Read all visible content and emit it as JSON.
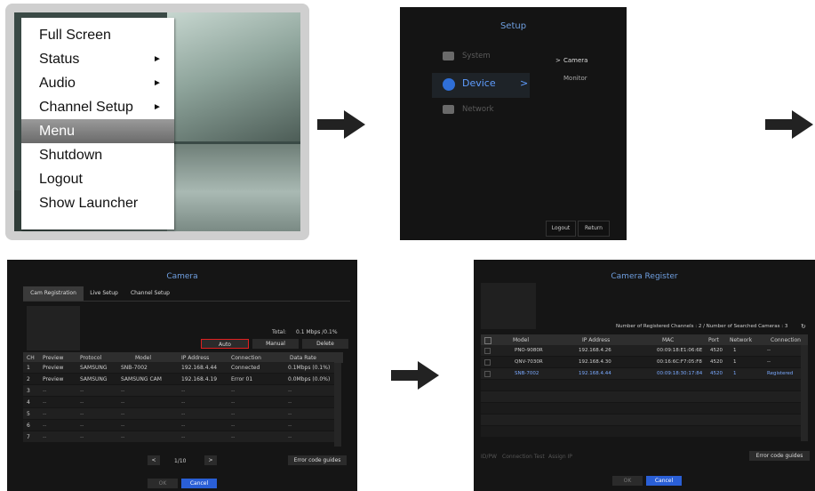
{
  "menu": {
    "items": [
      {
        "label": "Full Screen",
        "submenu": false
      },
      {
        "label": "Status",
        "submenu": true
      },
      {
        "label": "Audio",
        "submenu": true
      },
      {
        "label": "Channel Setup",
        "submenu": true
      },
      {
        "label": "Menu",
        "submenu": false,
        "selected": true
      },
      {
        "label": "Shutdown",
        "submenu": false
      },
      {
        "label": "Logout",
        "submenu": false
      },
      {
        "label": "Show Launcher",
        "submenu": false
      }
    ],
    "submenu_glyph": "►"
  },
  "setup": {
    "title": "Setup",
    "items": [
      {
        "label": "System",
        "icon": "monitor-gear-icon"
      },
      {
        "label": "Device",
        "icon": "camera-icon",
        "active": true
      },
      {
        "label": "Network",
        "icon": "network-icon"
      }
    ],
    "submenu": [
      "Camera",
      "Monitor"
    ],
    "submenu_prefix": ">",
    "device_chevron": ">",
    "logout_label": "Logout",
    "return_label": "Return"
  },
  "camera": {
    "title": "Camera",
    "tabs": [
      "Cam Registration",
      "Live Setup",
      "Channel Setup"
    ],
    "total_label": "Total:",
    "total_value": "0.1  Mbps /0.1%",
    "auto_label": "Auto",
    "manual_label": "Manual",
    "delete_label": "Delete",
    "columns": [
      "CH",
      "Preview",
      "Protocol",
      "Model",
      "IP Address",
      "Connection",
      "Data Rate"
    ],
    "rows": [
      [
        "1",
        "Preview",
        "SAMSUNG",
        "SNB-7002",
        "192.168.4.44",
        "Connected",
        "0.1Mbps (0.1%)"
      ],
      [
        "2",
        "Preview",
        "SAMSUNG",
        "SAMSUNG CAM",
        "192.168.4.19",
        "Error 01",
        "0.0Mbps (0.0%)"
      ],
      [
        "3",
        "--",
        "--",
        "--",
        "--",
        "--",
        "--"
      ],
      [
        "4",
        "--",
        "--",
        "--",
        "--",
        "--",
        "--"
      ],
      [
        "5",
        "--",
        "--",
        "--",
        "--",
        "--",
        "--"
      ],
      [
        "6",
        "--",
        "--",
        "--",
        "--",
        "--",
        "--"
      ],
      [
        "7",
        "--",
        "--",
        "--",
        "--",
        "--",
        "--"
      ]
    ],
    "page_prev": "<",
    "page_next": ">",
    "page_label": "1/10",
    "error_guides": "Error code guides",
    "ok_label": "OK",
    "cancel_label": "Cancel"
  },
  "register": {
    "title": "Camera Register",
    "summary": "Number of Registered Channels : 2 / Number of Searched Cameras : 3",
    "refresh_glyph": "↻",
    "columns": [
      "Model",
      "IP Address",
      "MAC",
      "Port",
      "Network",
      "Connection"
    ],
    "rows": [
      {
        "cells": [
          "PNO-9080R",
          "192.168.4.26",
          "00:09:18:E1:06:6E",
          "4520",
          "1",
          "--"
        ],
        "highlight": false
      },
      {
        "cells": [
          "QNV-7030R",
          "192.168.4.30",
          "00:16:6C:F7:05:F8",
          "4520",
          "1",
          "--"
        ],
        "highlight": false
      },
      {
        "cells": [
          "SNB-7002",
          "192.168.4.44",
          "00:09:18:30:17:84",
          "4520",
          "1",
          "Registered"
        ],
        "highlight": true
      }
    ],
    "footer_buttons": [
      "ID/PW",
      "Connection Test",
      "Assign IP"
    ],
    "error_guides": "Error code guides",
    "ok_label": "OK",
    "cancel_label": "Cancel"
  },
  "colors": {
    "accent": "#2a5fd6",
    "title": "#6f9fe0",
    "highlight_text": "#7aa9ff",
    "auto_outline": "#e02020"
  }
}
